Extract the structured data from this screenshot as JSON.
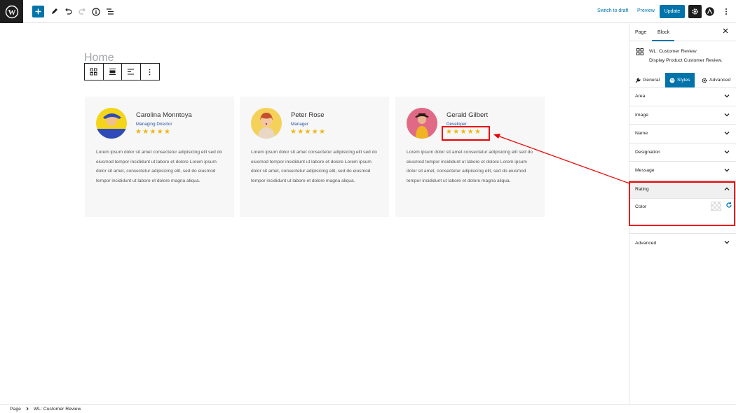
{
  "topbar": {
    "switch_to_draft": "Switch to draft",
    "preview": "Preview",
    "update": "Update"
  },
  "editor": {
    "page_title": "Home"
  },
  "cards": [
    {
      "name": "Carolina Monntoya",
      "role": "Managing Director",
      "stars": "★★★★★",
      "rating": 5,
      "message": "Lorem ipsum dolor sit amet consectetur adipisicing elit sed do eiusmod tempor incididunt ut labore et dolore Lorem ipsum dolor sit amet, consectetur adipisicing elit, sed do eiusmod tempor incididunt ut labore et dolore magna aliqua."
    },
    {
      "name": "Peter Rose",
      "role": "Manager",
      "stars": "★★★★★",
      "rating": 5,
      "message": "Lorem ipsum dolor sit amet consectetur adipisicing elit sed do eiusmod tempor incididunt ut labore et dolore Lorem ipsum dolor sit amet, consectetur adipisicing elit, sed do eiusmod tempor incididunt ut labore et dolore magna aliqua."
    },
    {
      "name": "Gerald Gilbert",
      "role": "Developer",
      "stars": "★★★★★",
      "rating": 5,
      "message": "Lorem ipsum dolor sit amet consectetur adipisicing elit sed do eiusmod tempor incididunt ut labore et dolore Lorem ipsum dolor sit amet, consectetur adipisicing elit, sed do eiusmod tempor incididunt ut labore et dolore magna aliqua."
    }
  ],
  "sidebar": {
    "tabs": [
      "Page",
      "Block"
    ],
    "block_title": "WL: Customer Review",
    "block_desc": "Display Product Customer Review.",
    "style_tabs": [
      "General",
      "Styles",
      "Advanced"
    ],
    "panels": [
      "Area",
      "Image",
      "Name",
      "Designation",
      "Message",
      "Rating"
    ],
    "rating_color_label": "Color",
    "advanced_panel": "Advanced"
  },
  "breadcrumb": {
    "page": "Page",
    "block": "WL: Customer Review"
  },
  "colors": {
    "accent": "#0073aa",
    "star": "#f2b617",
    "highlight": "#ee0000"
  }
}
